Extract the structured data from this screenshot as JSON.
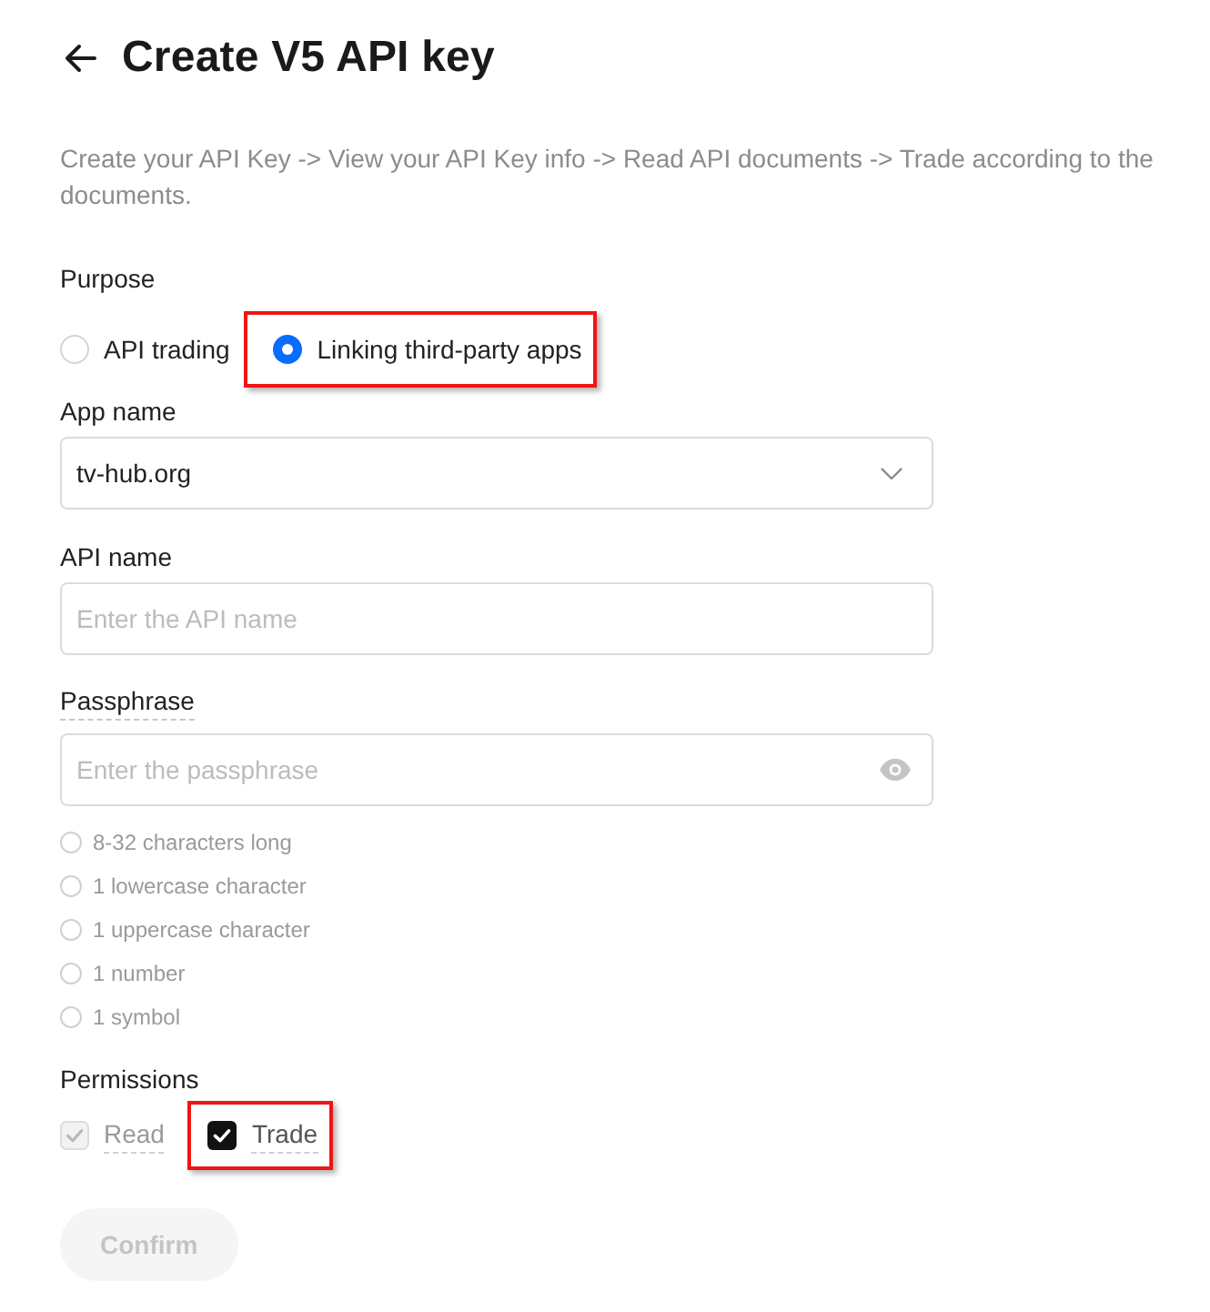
{
  "header": {
    "title": "Create V5 API key"
  },
  "description": "Create your API Key -> View your API Key info -> Read API documents -> Trade according to the documents.",
  "purpose": {
    "label": "Purpose",
    "options": [
      {
        "label": "API trading",
        "selected": false,
        "highlighted": false
      },
      {
        "label": "Linking third-party apps",
        "selected": true,
        "highlighted": true
      }
    ]
  },
  "app_name": {
    "label": "App name",
    "value": "tv-hub.org"
  },
  "api_name": {
    "label": "API name",
    "placeholder": "Enter the API name"
  },
  "passphrase": {
    "label": "Passphrase",
    "placeholder": "Enter the passphrase",
    "requirements": [
      {
        "text": "8-32 characters long",
        "met": false
      },
      {
        "text": "1 lowercase character",
        "met": false
      },
      {
        "text": "1 uppercase character",
        "met": false
      },
      {
        "text": "1 number",
        "met": false
      },
      {
        "text": "1 symbol",
        "met": false
      }
    ]
  },
  "permissions": {
    "label": "Permissions",
    "options": [
      {
        "label": "Read",
        "checked": true,
        "disabled": true,
        "highlighted": false
      },
      {
        "label": "Trade",
        "checked": true,
        "disabled": false,
        "highlighted": true
      }
    ]
  },
  "confirm_button": {
    "label": "Confirm",
    "disabled": true
  }
}
